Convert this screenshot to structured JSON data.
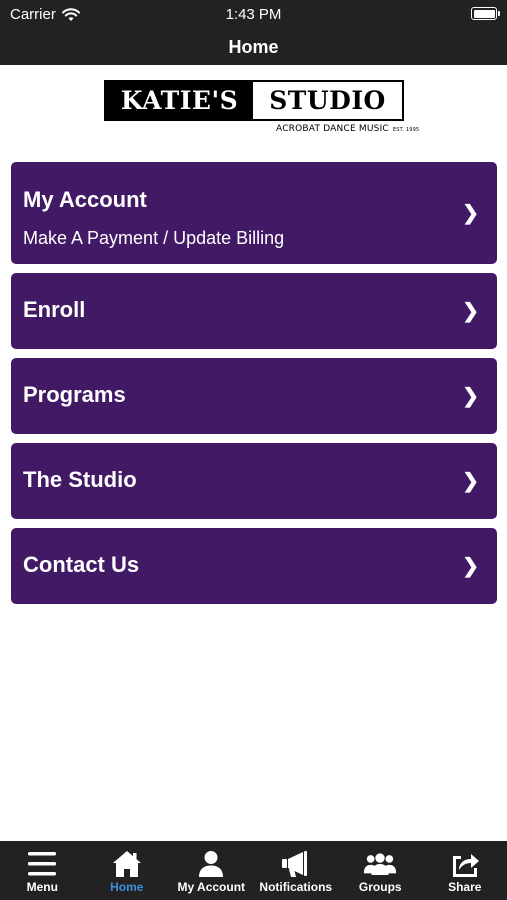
{
  "status_bar": {
    "carrier": "Carrier",
    "time": "1:43 PM"
  },
  "nav": {
    "title": "Home"
  },
  "logo": {
    "name_left": "KATIE'S",
    "name_right": "STUDIO",
    "tagline": "ACROBAT DANCE MUSIC",
    "established": "EST. 1995"
  },
  "menu": {
    "items": [
      {
        "title": "My Account",
        "subtitle": "Make A Payment / Update Billing",
        "icon": "chevron-right-icon"
      },
      {
        "title": "Enroll",
        "icon": "chevron-right-icon"
      },
      {
        "title": "Programs",
        "icon": "chevron-right-icon"
      },
      {
        "title": "The Studio",
        "icon": "chevron-right-icon"
      },
      {
        "title": "Contact Us",
        "icon": "chevron-right-icon"
      }
    ],
    "chevron_glyph": "❯"
  },
  "tabs": [
    {
      "label": "Menu",
      "icon": "menu-icon"
    },
    {
      "label": "Home",
      "icon": "home-icon",
      "active": true
    },
    {
      "label": "My Account",
      "icon": "person-icon"
    },
    {
      "label": "Notifications",
      "icon": "megaphone-icon"
    },
    {
      "label": "Groups",
      "icon": "groups-icon"
    },
    {
      "label": "Share",
      "icon": "share-icon"
    }
  ],
  "colors": {
    "card_purple": "#421964",
    "bar_dark": "#222222",
    "active_tab": "#3c8fd9"
  }
}
